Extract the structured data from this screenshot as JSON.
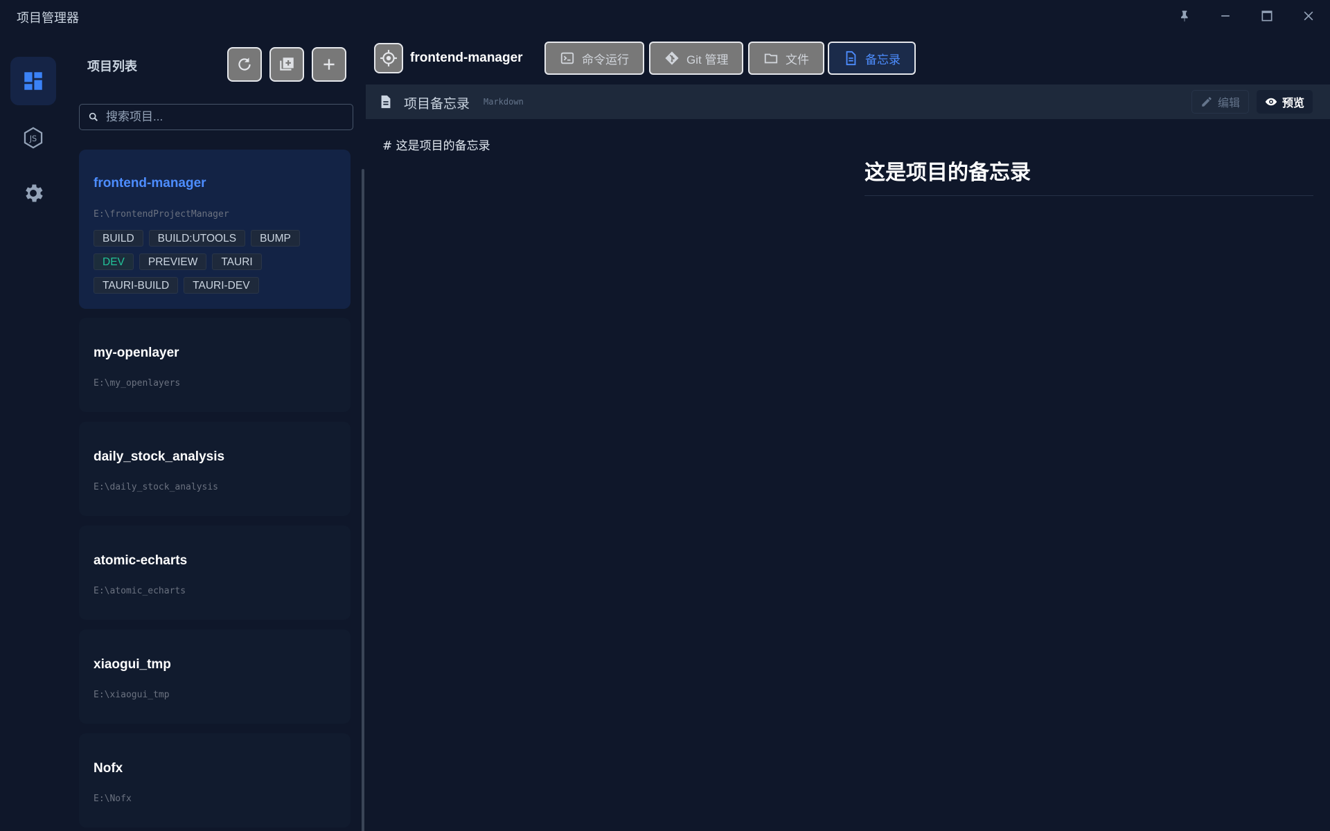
{
  "app": {
    "title": "项目管理器"
  },
  "sidebar": {
    "title": "项目列表",
    "search_placeholder": "搜索项目...",
    "projects": [
      {
        "name": "frontend-manager",
        "path": "E:\\frontendProjectManager",
        "active": true,
        "scripts": [
          "BUILD",
          "BUILD:UTOOLS",
          "BUMP",
          "DEV",
          "PREVIEW",
          "TAURI",
          "TAURI-BUILD",
          "TAURI-DEV"
        ],
        "running_script": "DEV"
      },
      {
        "name": "my-openlayer",
        "path": "E:\\my_openlayers"
      },
      {
        "name": "daily_stock_analysis",
        "path": "E:\\daily_stock_analysis"
      },
      {
        "name": "atomic-echarts",
        "path": "E:\\atomic_echarts"
      },
      {
        "name": "xiaogui_tmp",
        "path": "E:\\xiaogui_tmp"
      },
      {
        "name": "Nofx",
        "path": "E:\\Nofx"
      }
    ]
  },
  "main": {
    "project_name": "frontend-manager",
    "tabs": [
      {
        "label": "命令运行",
        "icon": "terminal-icon"
      },
      {
        "label": "Git 管理",
        "icon": "git-icon"
      },
      {
        "label": "文件",
        "icon": "folder-icon"
      },
      {
        "label": "备忘录",
        "icon": "document-icon",
        "active": true
      }
    ],
    "memo": {
      "title": "项目备忘录",
      "format": "Markdown",
      "edit_label": "编辑",
      "preview_label": "预览",
      "source": "# 这是项目的备忘录",
      "rendered_heading": "这是项目的备忘录"
    }
  },
  "colors": {
    "accent": "#4d8dff",
    "running": "#22c39a",
    "background": "#0f172a"
  }
}
